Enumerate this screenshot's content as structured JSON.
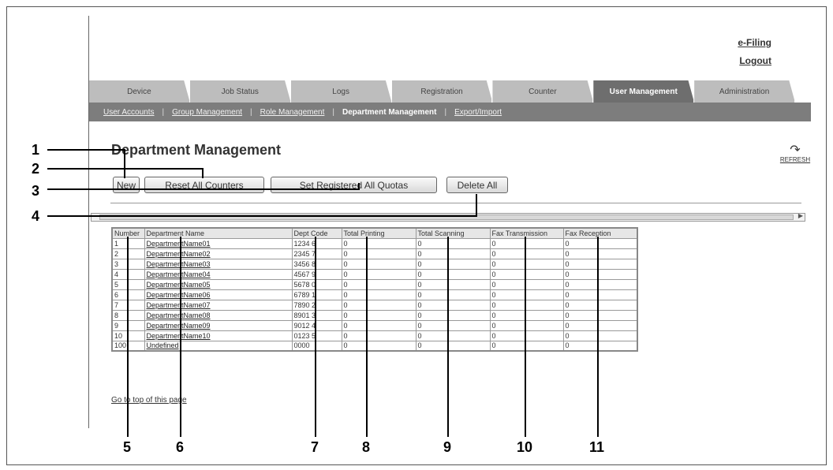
{
  "header": {
    "efiling": "e-Filing",
    "logout": "Logout"
  },
  "tabs": [
    "Device",
    "Job Status",
    "Logs",
    "Registration",
    "Counter",
    "User Management",
    "Administration"
  ],
  "active_tab": "User Management",
  "subnav": {
    "user_accounts": "User Accounts",
    "group_management": "Group Management",
    "role_management": "Role Management",
    "department_management": "Department Management",
    "export_import": "Export/Import"
  },
  "page": {
    "title": "Department Management",
    "refresh": "REFRESH"
  },
  "buttons": {
    "new": "New",
    "reset": "Reset All Counters",
    "set_quotas": "Set Registered All Quotas",
    "delete_all": "Delete All"
  },
  "table": {
    "headers": [
      "Number",
      "Department Name",
      "Dept Code",
      "Total Printing",
      "Total Scanning",
      "Fax Transmission",
      "Fax Reception"
    ],
    "rows": [
      [
        "1",
        "DepartmentName01",
        "1234 6",
        "0",
        "0",
        "0",
        "0"
      ],
      [
        "2",
        "DepartmentName02",
        "2345 7",
        "0",
        "0",
        "0",
        "0"
      ],
      [
        "3",
        "DepartmentName03",
        "3456 8",
        "0",
        "0",
        "0",
        "0"
      ],
      [
        "4",
        "DepartmentName04",
        "4567 9",
        "0",
        "0",
        "0",
        "0"
      ],
      [
        "5",
        "DepartmentName05",
        "5678 0",
        "0",
        "0",
        "0",
        "0"
      ],
      [
        "6",
        "DepartmentName06",
        "6789 1",
        "0",
        "0",
        "0",
        "0"
      ],
      [
        "7",
        "DepartmentName07",
        "7890 2",
        "0",
        "0",
        "0",
        "0"
      ],
      [
        "8",
        "DepartmentName08",
        "8901 3",
        "0",
        "0",
        "0",
        "0"
      ],
      [
        "9",
        "DepartmentName09",
        "9012 4",
        "0",
        "0",
        "0",
        "0"
      ],
      [
        "10",
        "DepartmentName10",
        "0123 5",
        "0",
        "0",
        "0",
        "0"
      ],
      [
        "100",
        "Undefined",
        "0000",
        "0",
        "0",
        "0",
        "0"
      ]
    ]
  },
  "go_top": "Go to top of this page",
  "callouts": [
    "1",
    "2",
    "3",
    "4",
    "5",
    "6",
    "7",
    "8",
    "9",
    "10",
    "11"
  ]
}
